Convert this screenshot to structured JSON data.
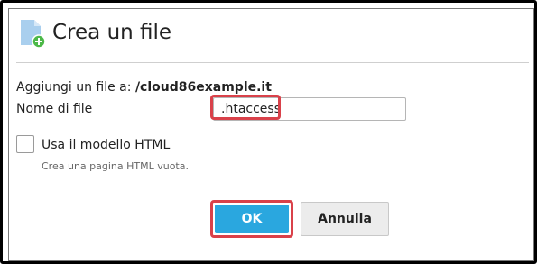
{
  "dialog": {
    "title": "Crea un file",
    "title_icon": "new-file-icon"
  },
  "form": {
    "destination_label": "Aggiungi un file a:",
    "destination_value": "/cloud86example.it",
    "filename_label": "Nome di file",
    "filename_value": ".htaccess",
    "html_template_label": "Usa il modello HTML",
    "html_template_checked": false,
    "html_template_hint": "Crea una pagina HTML vuota."
  },
  "buttons": {
    "ok_label": "OK",
    "cancel_label": "Annulla"
  },
  "colors": {
    "highlight": "#d9414a",
    "primary_button": "#2aa7df",
    "icon_blue": "#a9cfee",
    "icon_green": "#4cb848"
  }
}
